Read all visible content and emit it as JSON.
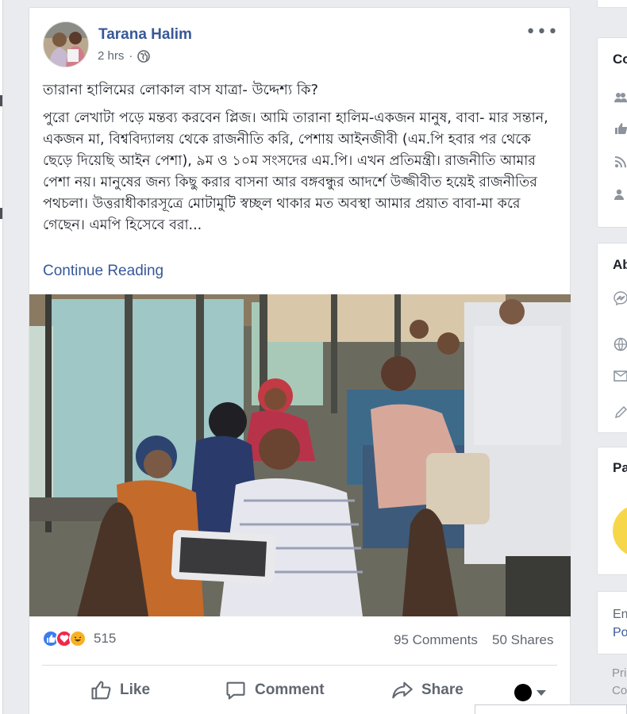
{
  "post": {
    "author": "Tarana Halim",
    "time": "2 hrs",
    "headline": "তারানা হালিমের লোকাল বাস যাত্রা- উদ্দেশ্য কি?",
    "body": "পুরো লেখাটা পড়ে মন্তব্য করবেন প্লিজ। আমি তারানা হালিম-একজন মানুষ, বাবা- মার সন্তান, একজন মা, বিশ্ববিদ্যালয় থেকে রাজনীতি করি, পেশায় আইনজীবী (এম.পি হবার পর থেকে ছেড়ে দিয়েছি আইন পেশা), ৯ম ও ১০ম সংসদের এম.পি। এখন প্রতিমন্ত্রী। রাজনীতি আমার পেশা নয়। মানুষের জন্য কিছু করার বাসনা আর বঙ্গবন্ধুর আদর্শে উজ্জীবীত হয়েই রাজনীতির পথচলা। উত্তরাধীকারসূত্রে মোটামুটি স্বচ্ছল থাকার মত অবস্থা আমার প্রয়াত বাবা-মা করে গেছেন। এমপি হিসেবে বরা...",
    "continue_label": "Continue Reading"
  },
  "stats": {
    "reaction_count": "515",
    "comments": "95 Comments",
    "shares": "50 Shares",
    "reaction_icons": [
      "like-icon",
      "love-icon",
      "haha-icon"
    ]
  },
  "actions": {
    "like": "Like",
    "comment": "Comment",
    "share": "Share"
  },
  "right_column": {
    "card2_title": "Co",
    "card3_title": "Ab",
    "card4_title": "Pa",
    "card5_line1": "En",
    "card5_line2": "Po",
    "card6_line1": "Pri",
    "card6_line2": "Co"
  },
  "colors": {
    "link": "#385898",
    "like": "#3b7bf0",
    "love": "#f0284a",
    "haha": "#f7b125"
  }
}
